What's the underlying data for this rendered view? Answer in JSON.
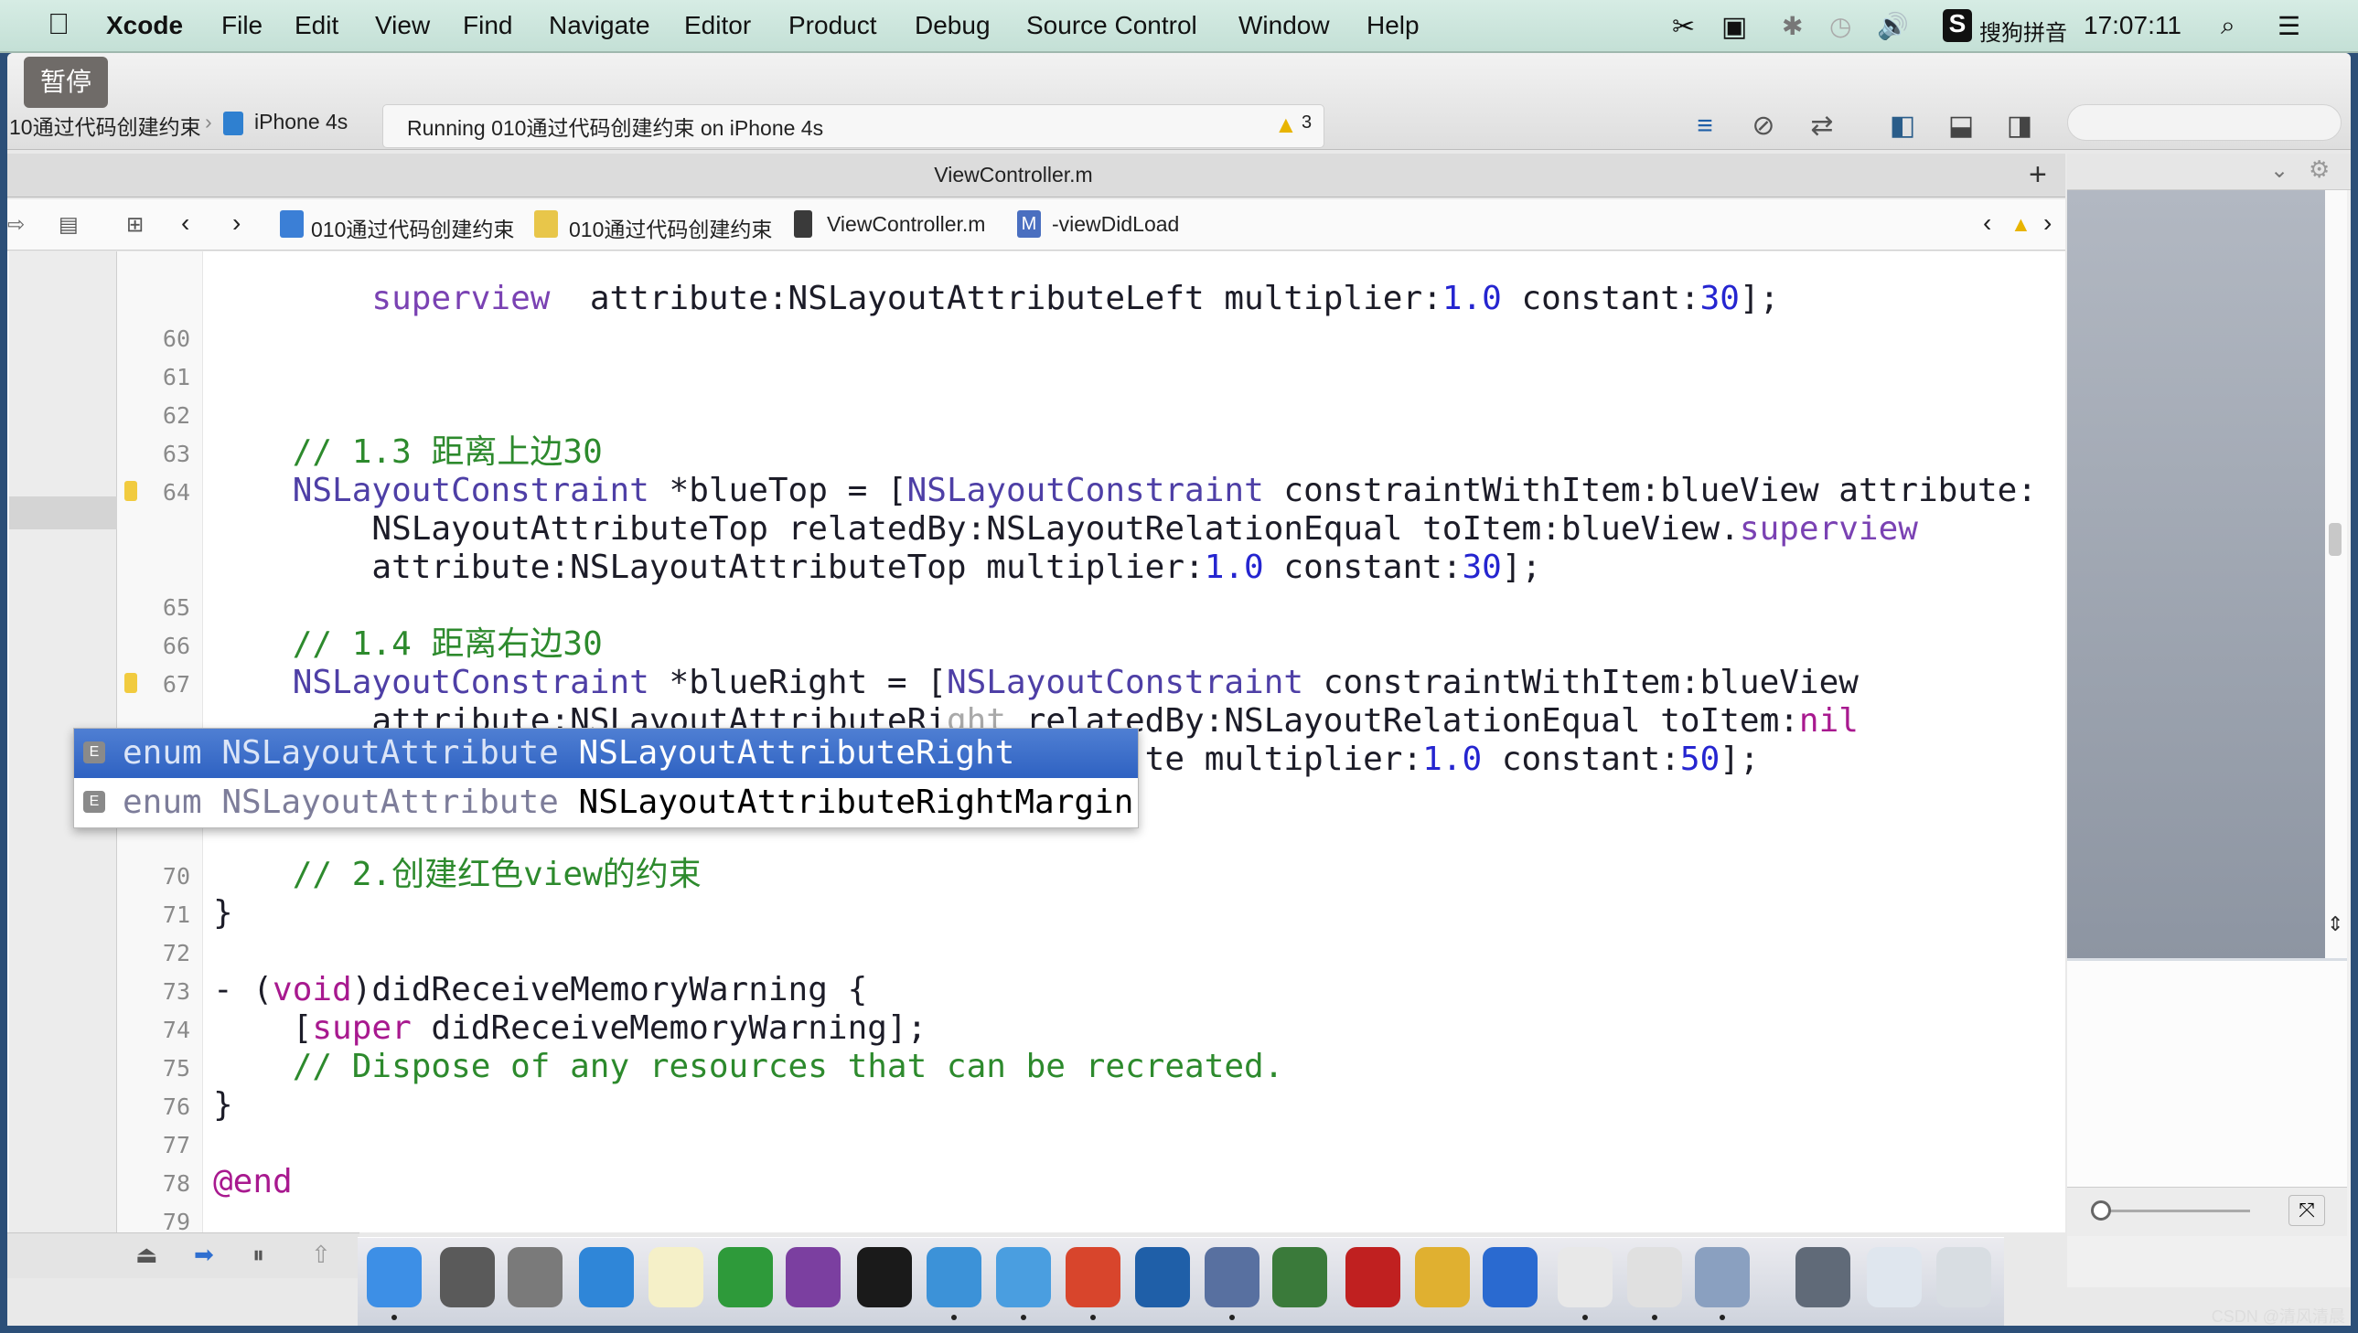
{
  "menubar": {
    "items": [
      "Xcode",
      "File",
      "Edit",
      "View",
      "Find",
      "Navigate",
      "Editor",
      "Product",
      "Debug",
      "Source Control",
      "Window",
      "Help"
    ],
    "input_method": "搜狗拼音",
    "clock": "17:07:11",
    "status_icons": [
      "scissors-icon",
      "screen-record-icon",
      "bluetooth-icon",
      "time-machine-icon",
      "volume-icon",
      "sogou-icon"
    ]
  },
  "overlay": {
    "pause_label": "暂停"
  },
  "toolbar": {
    "scheme": "10通过代码创建约束",
    "device": "iPhone 4s",
    "status": "Running 010通过代码创建约束 on iPhone 4s",
    "warning_count": "3"
  },
  "tab": {
    "title": "ViewController.m",
    "add": "+"
  },
  "jumpbar": {
    "items": [
      "010通过代码创建约束",
      "010通过代码创建约束",
      "ViewController.m",
      "-viewDidLoad"
    ]
  },
  "editor": {
    "lines": [
      {
        "n": "",
        "t": [
          [
            "        ",
            ""
          ],
          [
            "superview",
            "sup"
          ],
          [
            "  attribute:NSLayoutAttributeLeft multiplier:",
            ""
          ],
          [
            "1.0",
            "num"
          ],
          [
            " constant:",
            ""
          ],
          [
            "30",
            "num"
          ],
          [
            "];",
            ""
          ]
        ]
      },
      {
        "n": "60",
        "t": []
      },
      {
        "n": "61",
        "t": []
      },
      {
        "n": "62",
        "t": []
      },
      {
        "n": "63",
        "t": [
          [
            "    // 1.3 距离上边30",
            "cmt"
          ]
        ]
      },
      {
        "n": "64",
        "w": true,
        "t": [
          [
            "    ",
            ""
          ],
          [
            "NSLayoutConstraint",
            "cls"
          ],
          [
            " *blueTop = [",
            ""
          ],
          [
            "NSLayoutConstraint",
            "cls"
          ],
          [
            " constraintWithItem:blueView attribute:",
            ""
          ]
        ]
      },
      {
        "n": "",
        "t": [
          [
            "        NSLayoutAttributeTop relatedBy:NSLayoutRelationEqual toItem:blueView.",
            ""
          ],
          [
            "superview",
            "sup"
          ]
        ]
      },
      {
        "n": "",
        "t": [
          [
            "        attribute:NSLayoutAttributeTop multiplier:",
            ""
          ],
          [
            "1.0",
            "num"
          ],
          [
            " constant:",
            ""
          ],
          [
            "30",
            "num"
          ],
          [
            "];",
            ""
          ]
        ]
      },
      {
        "n": "65",
        "t": []
      },
      {
        "n": "66",
        "t": [
          [
            "    // 1.4 距离右边30",
            "cmt"
          ]
        ]
      },
      {
        "n": "67",
        "w": true,
        "t": [
          [
            "    ",
            ""
          ],
          [
            "NSLayoutConstraint",
            "cls"
          ],
          [
            " *blueRight = [",
            ""
          ],
          [
            "NSLayoutConstraint",
            "cls"
          ],
          [
            " constraintWithItem:blueView",
            ""
          ]
        ]
      },
      {
        "n": "",
        "t": [
          [
            "        attribute:NSLayoutAttributeRi",
            ""
          ],
          [
            "ght",
            "comp"
          ],
          [
            " relatedBy:NSLayoutRelationEqual toItem:",
            ""
          ],
          [
            "nil",
            "kw"
          ]
        ]
      },
      {
        "n": "",
        "t": [
          [
            "                                               te multiplier:",
            ""
          ],
          [
            "1.0",
            "num"
          ],
          [
            " constant:",
            ""
          ],
          [
            "50",
            "num"
          ],
          [
            "];",
            ""
          ]
        ]
      },
      {
        "n": "",
        "t": []
      },
      {
        "n": "",
        "t": []
      },
      {
        "n": "70",
        "t": [
          [
            "    // 2.创建红色view的约束",
            "cmt"
          ]
        ]
      },
      {
        "n": "71",
        "t": [
          [
            "}",
            ""
          ]
        ]
      },
      {
        "n": "72",
        "t": []
      },
      {
        "n": "73",
        "t": [
          [
            "- (",
            ""
          ],
          [
            "void",
            "kw"
          ],
          [
            ")didReceiveMemoryWarning {",
            ""
          ]
        ]
      },
      {
        "n": "74",
        "t": [
          [
            "    [",
            ""
          ],
          [
            "super",
            "kw"
          ],
          [
            " didReceiveMemoryWarning];",
            ""
          ]
        ]
      },
      {
        "n": "75",
        "t": [
          [
            "    // Dispose of any resources that can be recreated.",
            "cmt"
          ]
        ]
      },
      {
        "n": "76",
        "t": [
          [
            "}",
            ""
          ]
        ]
      },
      {
        "n": "77",
        "t": []
      },
      {
        "n": "78",
        "t": [
          [
            "@end",
            "kw"
          ]
        ]
      },
      {
        "n": "79",
        "t": []
      }
    ]
  },
  "autocomplete": {
    "items": [
      {
        "kind": "enum",
        "type": "NSLayoutAttribute",
        "name": "NSLayoutAttributeRight",
        "selected": true
      },
      {
        "kind": "enum",
        "type": "NSLayoutAttribute",
        "name": "NSLayoutAttributeRightMargin",
        "selected": false
      }
    ]
  },
  "dock": {
    "apps": [
      {
        "icon": "finder-icon",
        "color": "#3d8fe6"
      },
      {
        "icon": "system-preferences-icon",
        "color": "#5a5a5a"
      },
      {
        "icon": "launchpad-icon",
        "color": "#7a7a7a"
      },
      {
        "icon": "safari-icon",
        "color": "#2f86d8"
      },
      {
        "icon": "notes-icon",
        "color": "#f5f0c8"
      },
      {
        "icon": "excel-icon",
        "color": "#2e9a3a"
      },
      {
        "icon": "onenote-icon",
        "color": "#7b3fa0"
      },
      {
        "icon": "terminal-icon",
        "color": "#1a1a1a"
      },
      {
        "icon": "xcode-icon",
        "color": "#3c92d8"
      },
      {
        "icon": "folder-icon",
        "color": "#4a9ee0"
      },
      {
        "icon": "powerpoint-icon",
        "color": "#d8452c"
      },
      {
        "icon": "instruments-icon",
        "color": "#1f5fa8"
      },
      {
        "icon": "photo-slideshow-icon",
        "color": "#5870a0"
      },
      {
        "icon": "network-utility-icon",
        "color": "#3a7a3a"
      },
      {
        "icon": "filezilla-icon",
        "color": "#c02020"
      },
      {
        "icon": "pencil-app-icon",
        "color": "#e0b030"
      },
      {
        "icon": "word-icon",
        "color": "#2a6ad0"
      },
      {
        "icon": "document-icon",
        "color": "#e8e8e8"
      },
      {
        "icon": "document-icon",
        "color": "#e0e0e0"
      },
      {
        "icon": "preview-icon",
        "color": "#8aa0c0"
      },
      {
        "icon": "screen-sharing-icon",
        "color": "#606a78"
      },
      {
        "icon": "downloads-icon",
        "color": "#dfe6ee"
      },
      {
        "icon": "trash-icon",
        "color": "#d8dde2"
      }
    ]
  },
  "watermark": "CSDN @清风清晨"
}
